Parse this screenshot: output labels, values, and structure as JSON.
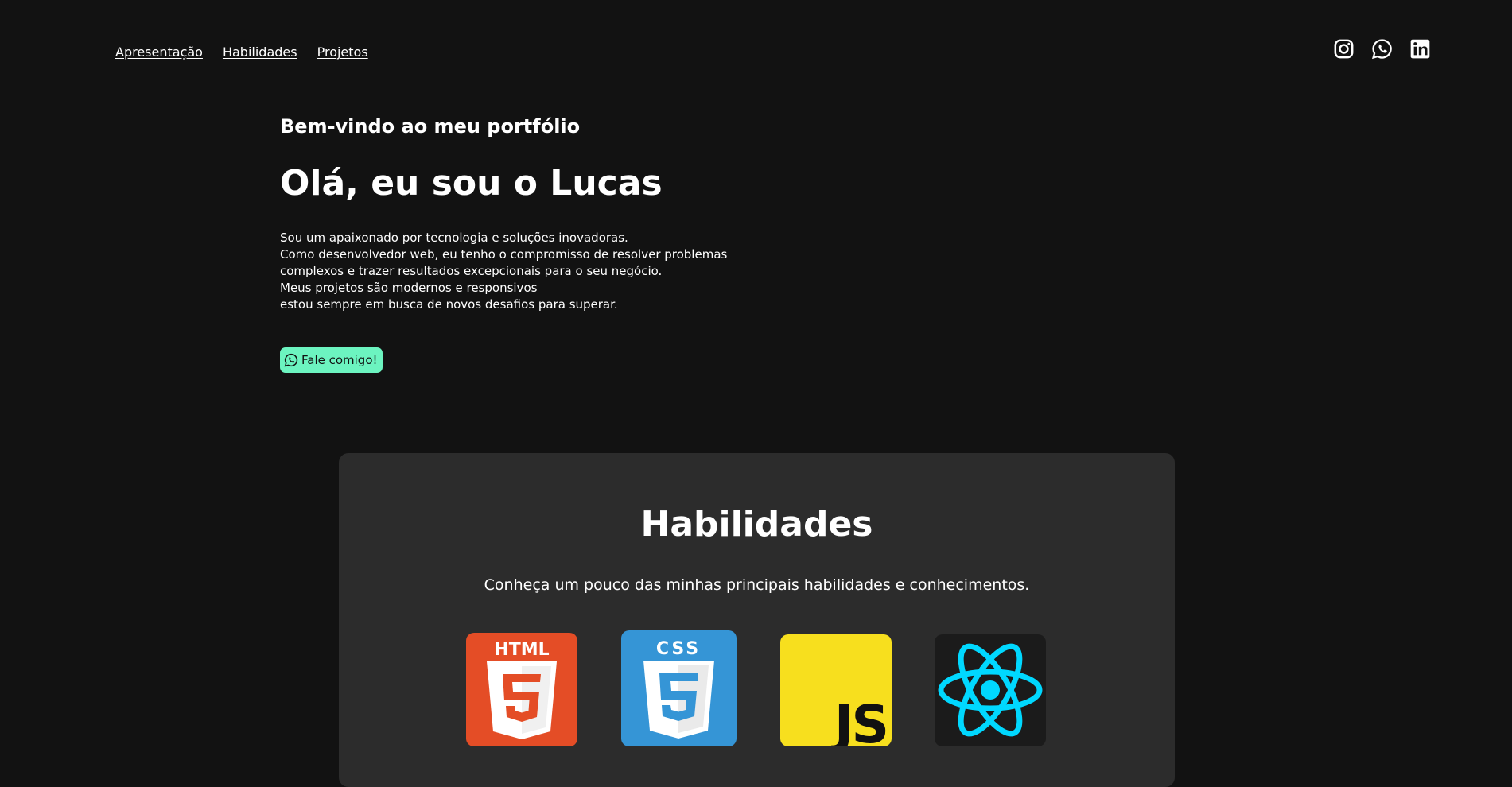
{
  "nav": {
    "items": [
      {
        "label": "Apresentação"
      },
      {
        "label": "Habilidades"
      },
      {
        "label": "Projetos"
      }
    ]
  },
  "social": {
    "icons": [
      "instagram-icon",
      "whatsapp-icon",
      "linkedin-icon"
    ]
  },
  "hero": {
    "welcome": "Bem-vindo ao meu portfólio",
    "title": "Olá, eu sou o Lucas",
    "bio_lines": [
      "Sou um apaixonado por tecnologia e soluções inovadoras.",
      "Como desenvolvedor web, eu tenho o compromisso de resolver problemas",
      "complexos e trazer resultados excepcionais para o seu negócio.",
      "Meus projetos são modernos e responsivos",
      "estou sempre em busca de novos desafios para superar."
    ],
    "cta_label": "Fale comigo!"
  },
  "skills": {
    "title": "Habilidades",
    "subtitle": "Conheça um pouco das minhas principais habilidades e conhecimentos.",
    "logos": [
      {
        "name": "html5-logo",
        "text": "HTML",
        "color": "#e44d26"
      },
      {
        "name": "css3-logo",
        "text": "CSS",
        "color": "#3595d6"
      },
      {
        "name": "javascript-logo",
        "text": "JS",
        "color": "#f7df1e"
      },
      {
        "name": "react-logo",
        "color": "#1b1b1b",
        "accent": "#00d8ff"
      }
    ]
  },
  "colors": {
    "background": "#121212",
    "card": "#2c2c2c",
    "accent": "#6cf4c0"
  }
}
